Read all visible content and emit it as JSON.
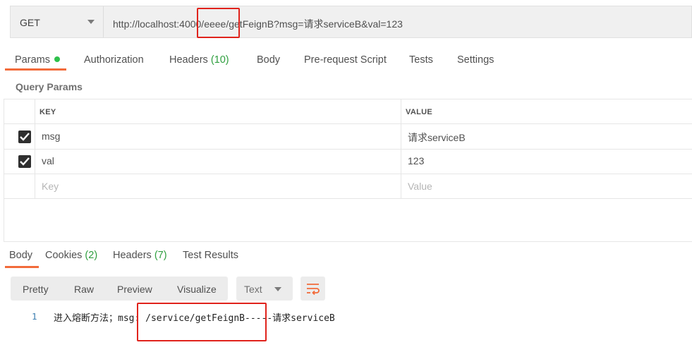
{
  "request": {
    "method": "GET",
    "url": "http://localhost:4000/eeee/getFeignB?msg=请求serviceB&val=123"
  },
  "request_tabs": [
    {
      "label": "Params"
    },
    {
      "label": "Authorization"
    },
    {
      "label": "Headers",
      "count": "(10)"
    },
    {
      "label": "Body"
    },
    {
      "label": "Pre-request Script"
    },
    {
      "label": "Tests"
    },
    {
      "label": "Settings"
    }
  ],
  "query_params": {
    "title": "Query Params",
    "columns": {
      "key": "KEY",
      "value": "VALUE"
    },
    "rows": [
      {
        "checked": true,
        "key": "msg",
        "value": "请求serviceB"
      },
      {
        "checked": true,
        "key": "val",
        "value": "123"
      }
    ],
    "new_row": {
      "key_placeholder": "Key",
      "value_placeholder": "Value"
    }
  },
  "response_tabs": [
    {
      "label": "Body"
    },
    {
      "label": "Cookies",
      "count": "(2)"
    },
    {
      "label": "Headers",
      "count": "(7)"
    },
    {
      "label": "Test Results"
    }
  ],
  "response_view": {
    "modes": [
      "Pretty",
      "Raw",
      "Preview",
      "Visualize"
    ],
    "format": "Text"
  },
  "response_body": {
    "lines": [
      {
        "number": "1",
        "text": "进入熔断方法；msg: /service/getFeignB-----请求serviceB"
      }
    ]
  },
  "colors": {
    "accent": "#f26b3a",
    "count_green": "#2e9e3e",
    "highlight_red": "#e0231c"
  }
}
